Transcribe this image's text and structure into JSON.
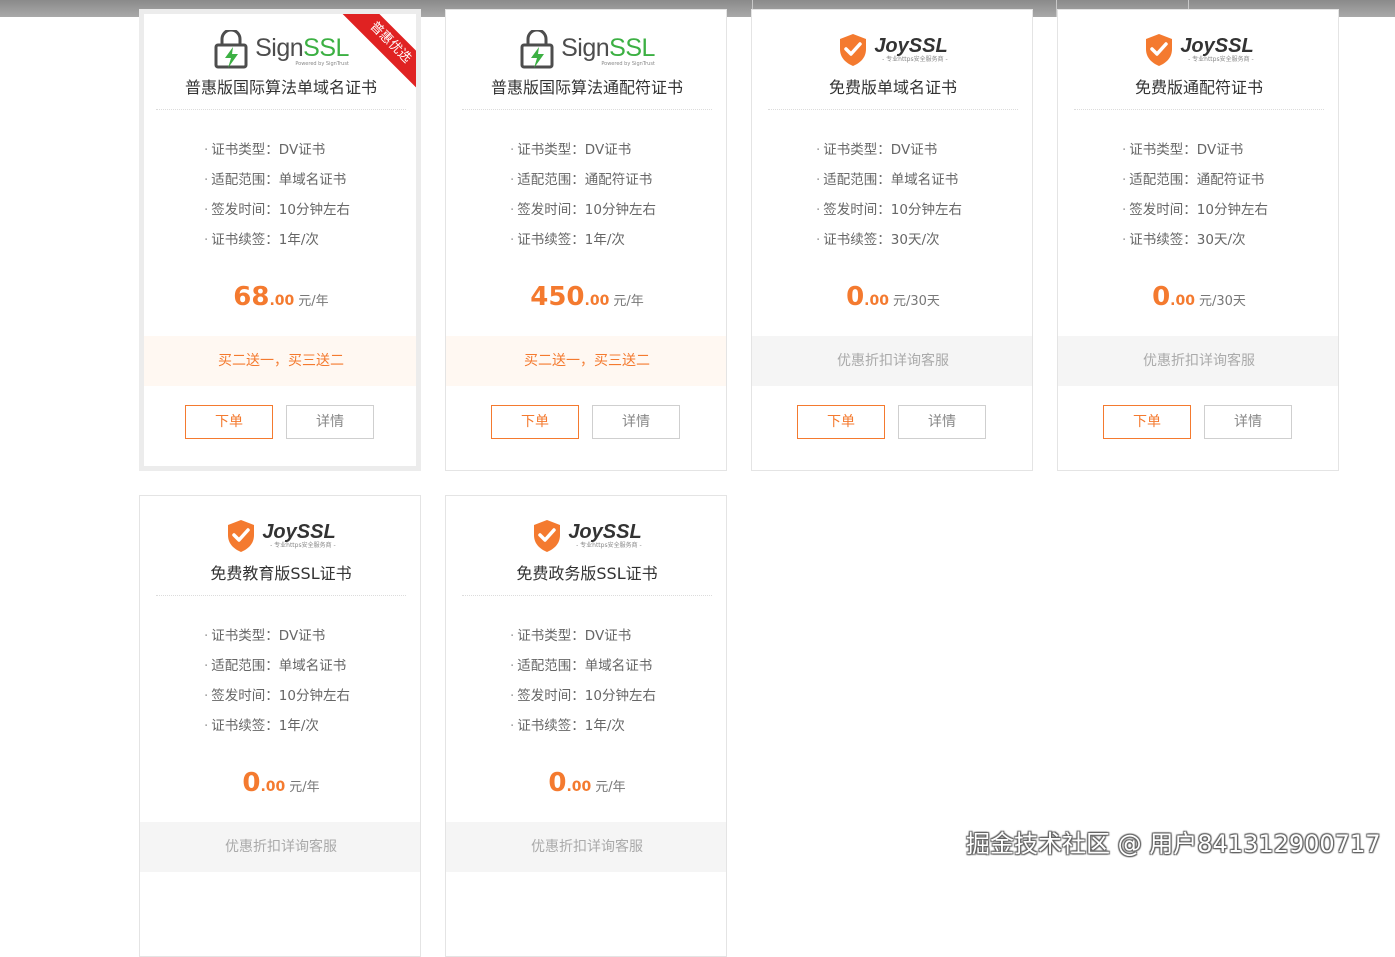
{
  "colors": {
    "accent": "#f47a2f",
    "ribbon": "#e02222",
    "sign_green": "#3cb043",
    "joy_orange": "#f47a2f"
  },
  "cards": [
    {
      "brand": "SignSSL",
      "brand_sign": "Sign",
      "brand_ssl": "SSL",
      "brand_sub": "Powered by SignTrust",
      "ribbon": "普惠优选",
      "title": "普惠版国际算法单域名证书",
      "features": [
        {
          "label": "证书类型：",
          "value": "DV证书"
        },
        {
          "label": "适配范围：",
          "value": "单域名证书"
        },
        {
          "label": "签发时间：",
          "value": "10分钟左右"
        },
        {
          "label": "证书续签：",
          "value": "1年/次"
        }
      ],
      "price_int": "68",
      "price_dec": ".00",
      "price_unit": "元/年",
      "promo": "买二送一，买三送二",
      "order_label": "下单",
      "detail_label": "详情"
    },
    {
      "brand": "SignSSL",
      "brand_sign": "Sign",
      "brand_ssl": "SSL",
      "brand_sub": "Powered by SignTrust",
      "title": "普惠版国际算法通配符证书",
      "features": [
        {
          "label": "证书类型：",
          "value": "DV证书"
        },
        {
          "label": "适配范围：",
          "value": "通配符证书"
        },
        {
          "label": "签发时间：",
          "value": "10分钟左右"
        },
        {
          "label": "证书续签：",
          "value": "1年/次"
        }
      ],
      "price_int": "450",
      "price_dec": ".00",
      "price_unit": "元/年",
      "promo": "买二送一，买三送二",
      "order_label": "下单",
      "detail_label": "详情"
    },
    {
      "brand": "JoySSL",
      "brand_sub": "- 专业https安全服务商 -",
      "title": "免费版单域名证书",
      "features": [
        {
          "label": "证书类型：",
          "value": "DV证书"
        },
        {
          "label": "适配范围：",
          "value": "单域名证书"
        },
        {
          "label": "签发时间：",
          "value": "10分钟左右"
        },
        {
          "label": "证书续签：",
          "value": "30天/次"
        }
      ],
      "price_int": "0",
      "price_dec": ".00",
      "price_unit": "元/30天",
      "promo": "优惠折扣详询客服",
      "order_label": "下单",
      "detail_label": "详情"
    },
    {
      "brand": "JoySSL",
      "brand_sub": "- 专业https安全服务商 -",
      "title": "免费版通配符证书",
      "features": [
        {
          "label": "证书类型：",
          "value": "DV证书"
        },
        {
          "label": "适配范围：",
          "value": "通配符证书"
        },
        {
          "label": "签发时间：",
          "value": "10分钟左右"
        },
        {
          "label": "证书续签：",
          "value": "30天/次"
        }
      ],
      "price_int": "0",
      "price_dec": ".00",
      "price_unit": "元/30天",
      "promo": "优惠折扣详询客服",
      "order_label": "下单",
      "detail_label": "详情"
    },
    {
      "brand": "JoySSL",
      "brand_sub": "- 专业https安全服务商 -",
      "title": "免费教育版SSL证书",
      "features": [
        {
          "label": "证书类型：",
          "value": "DV证书"
        },
        {
          "label": "适配范围：",
          "value": "单域名证书"
        },
        {
          "label": "签发时间：",
          "value": "10分钟左右"
        },
        {
          "label": "证书续签：",
          "value": "1年/次"
        }
      ],
      "price_int": "0",
      "price_dec": ".00",
      "price_unit": "元/年",
      "promo": "优惠折扣详询客服"
    },
    {
      "brand": "JoySSL",
      "brand_sub": "- 专业https安全服务商 -",
      "title": "免费政务版SSL证书",
      "features": [
        {
          "label": "证书类型：",
          "value": "DV证书"
        },
        {
          "label": "适配范围：",
          "value": "单域名证书"
        },
        {
          "label": "签发时间：",
          "value": "10分钟左右"
        },
        {
          "label": "证书续签：",
          "value": "1年/次"
        }
      ],
      "price_int": "0",
      "price_dec": ".00",
      "price_unit": "元/年",
      "promo": "优惠折扣详询客服"
    }
  ],
  "watermark": "掘金技术社区 @ 用户841312900717"
}
